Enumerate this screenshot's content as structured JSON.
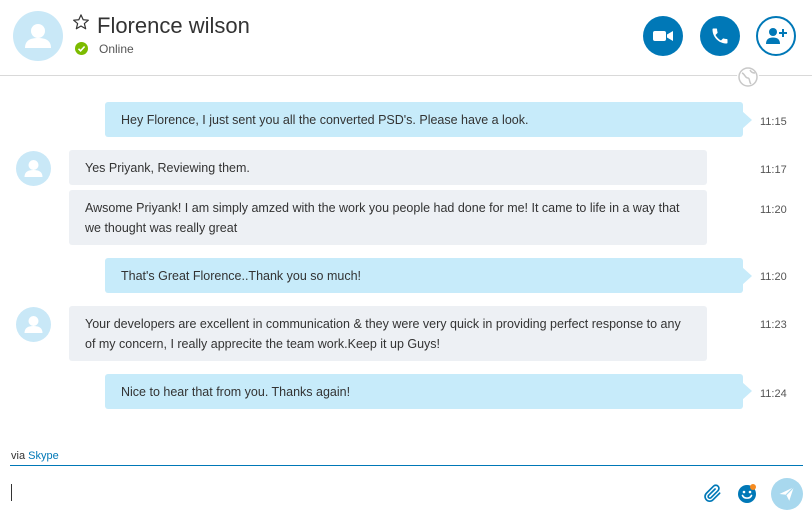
{
  "contact": {
    "name": "Florence wilson",
    "status": "Online"
  },
  "colors": {
    "accent": "#0078b7",
    "outgoing_bubble": "#c7ebfa",
    "incoming_bubble": "#edf0f4",
    "online": "#7cbb00"
  },
  "header_icons": [
    "star-icon",
    "video-call-icon",
    "phone-icon",
    "add-person-icon"
  ],
  "messages": [
    {
      "direction": "out",
      "text": "Hey Florence, I just sent you all the converted PSD's. Please have a look.",
      "time": "11:15"
    },
    {
      "direction": "in",
      "text": "Yes Priyank, Reviewing them.",
      "time": "11:17"
    },
    {
      "direction": "in",
      "text": "Awsome Priyank! I am simply amzed with the work you people had done for me! It came to life in a way that we thought was really great",
      "time": "11:20"
    },
    {
      "direction": "out",
      "text": "That's Great Florence..Thank you so much!",
      "time": "11:20"
    },
    {
      "direction": "in",
      "text": "Your developers are excellent in communication & they were very quick in providing perfect response to any of my concern, I really apprecite the team work.Keep it up Guys!",
      "time": "11:23"
    },
    {
      "direction": "out",
      "text": "Nice to hear that from you. Thanks again!",
      "time": "11:24"
    }
  ],
  "footer": {
    "via_prefix": "via",
    "via_link": "Skype",
    "compose_value": ""
  },
  "compose_icons": [
    "paperclip-icon",
    "emoji-icon",
    "send-icon"
  ]
}
